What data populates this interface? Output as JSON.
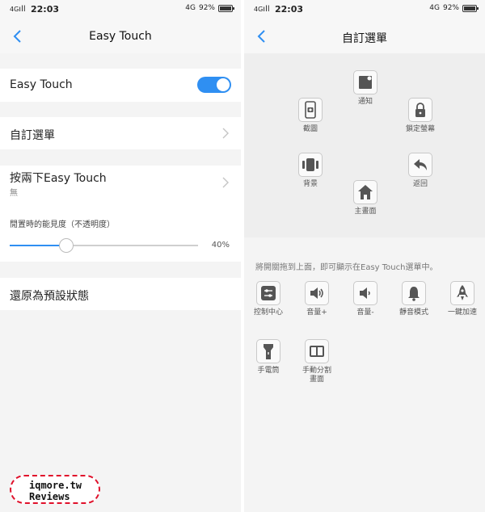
{
  "left": {
    "status": {
      "network": "4G",
      "time": "22:03",
      "data": "4G",
      "battery": "92%",
      "battery_level": 0.92
    },
    "header": {
      "title": "Easy Touch"
    },
    "easy_touch_row": {
      "label": "Easy Touch",
      "enabled": true
    },
    "custom_menu_row": {
      "label": "自訂選單"
    },
    "double_tap_row": {
      "label": "按兩下Easy Touch",
      "value": "無"
    },
    "opacity": {
      "label": "閒置時的能見度（不透明度）",
      "value_text": "40%",
      "value": 0.4
    },
    "reset_row": {
      "label": "還原為預設狀態"
    },
    "watermark": {
      "line1": "iqmore.tw",
      "line2": "Reviews"
    }
  },
  "right": {
    "status": {
      "network": "4G",
      "time": "22:03",
      "data": "4G",
      "battery": "92%",
      "battery_level": 0.92
    },
    "header": {
      "title": "自訂選單"
    },
    "menu_items": [
      {
        "label": "通知",
        "icon": "notification-icon"
      },
      {
        "label": "截圖",
        "icon": "screenshot-icon"
      },
      {
        "label": "鎖定螢幕",
        "icon": "lock-icon"
      },
      {
        "label": "背景",
        "icon": "background-apps-icon"
      },
      {
        "label": "返回",
        "icon": "back-arrow-icon"
      },
      {
        "label": "主畫面",
        "icon": "home-icon"
      }
    ],
    "hint": "將開關拖到上面，即可顯示在Easy Touch選單中。",
    "available_items": [
      {
        "label": "控制中心",
        "icon": "control-center-icon"
      },
      {
        "label": "音量+",
        "icon": "volume-up-icon"
      },
      {
        "label": "音量-",
        "icon": "volume-down-icon"
      },
      {
        "label": "靜音模式",
        "icon": "bell-icon"
      },
      {
        "label": "一鍵加速",
        "icon": "rocket-icon"
      },
      {
        "label": "手電筒",
        "icon": "flashlight-icon"
      },
      {
        "label": "手動分割畫面",
        "label_line2": "畫面",
        "icon": "split-screen-icon"
      }
    ]
  },
  "colors": {
    "accent": "#2f8ff2",
    "watermark": "#e0112b"
  }
}
